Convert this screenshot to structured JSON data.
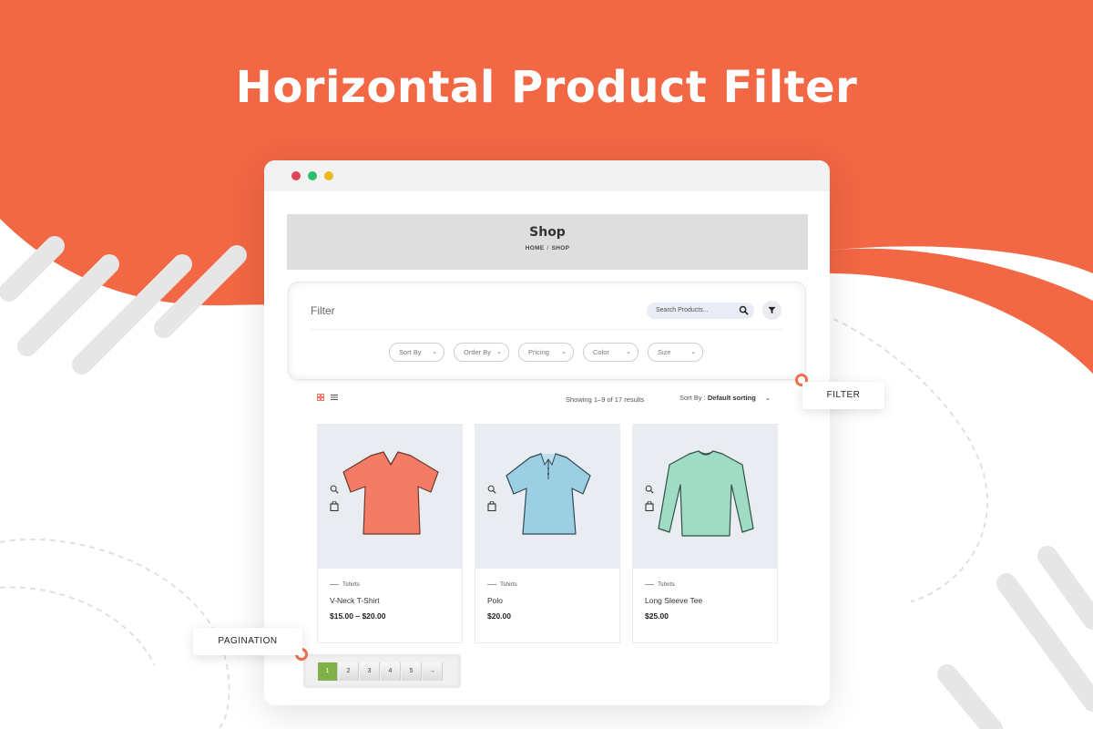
{
  "hero": {
    "title": "Horizontal Product Filter"
  },
  "colors": {
    "accent": "#f26744",
    "active_page": "#7fb04a"
  },
  "window": {
    "controls": [
      "red",
      "green",
      "yellow"
    ]
  },
  "shop": {
    "title": "Shop",
    "breadcrumb": [
      "HOME",
      "SHOP"
    ]
  },
  "filter": {
    "label": "Filter",
    "search_placeholder": "Search Products...",
    "dropdowns": [
      {
        "label": "Sort By"
      },
      {
        "label": "Order By"
      },
      {
        "label": "Pricing"
      },
      {
        "label": "Color"
      },
      {
        "label": "Size"
      }
    ]
  },
  "toolbar": {
    "results": "Showing 1–9 of 17 results",
    "sort_prefix": "Sort By :",
    "sort_value": "Default sorting"
  },
  "products": [
    {
      "category": "Tshirts",
      "name": "V-Neck T-Shirt",
      "price": "$15.00 – $20.00",
      "color": "#f47c66"
    },
    {
      "category": "Tshirts",
      "name": "Polo",
      "price": "$20.00",
      "color": "#9ccfe2"
    },
    {
      "category": "Tshirts",
      "name": "Long Sleeve Tee",
      "price": "$25.00",
      "color": "#9fdcc3"
    }
  ],
  "pagination": {
    "pages": [
      "1",
      "2",
      "3",
      "4",
      "5",
      "→"
    ],
    "current": "1"
  },
  "tags": {
    "filter": "FILTER",
    "pagination": "PAGINATION"
  }
}
